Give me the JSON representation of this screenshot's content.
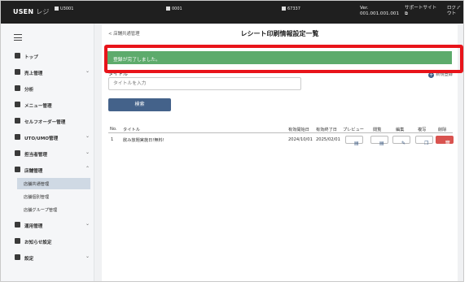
{
  "header": {
    "brand": "USEN",
    "brand_sub": "レジ",
    "store_code": "U3001",
    "terminal": "0001",
    "user": "67337",
    "version_label": "Ver.",
    "version": "001.001.001.001",
    "support_label": "サポートサイト",
    "logout_label": "ログアウト"
  },
  "sidebar": {
    "items": [
      {
        "label": "トップ"
      },
      {
        "label": "売上管理"
      },
      {
        "label": "分析"
      },
      {
        "label": "メニュー管理"
      },
      {
        "label": "セルフオーダー管理"
      },
      {
        "label": "UTO/UMO管理"
      },
      {
        "label": "担当者管理"
      },
      {
        "label": "店舗管理"
      },
      {
        "label": "運用管理"
      },
      {
        "label": "お知らせ設定"
      },
      {
        "label": "設定"
      }
    ],
    "subitems": [
      {
        "label": "店舗共通管理"
      },
      {
        "label": "店舗個別管理"
      },
      {
        "label": "店舗グループ管理"
      }
    ]
  },
  "main": {
    "back_label": "< 店舗共通管理",
    "page_title": "レシート印刷情報設定一覧",
    "alert_message": "登録が完了しました。",
    "field_label": "タイトル",
    "new_register_label": "新規登録",
    "title_placeholder": "タイトルを入力",
    "search_button": "検索",
    "table": {
      "columns": [
        "No.",
        "タイトル",
        "有効開始日",
        "有効終了日",
        "プレビュー",
        "閲覧",
        "編集",
        "複写",
        "削除"
      ],
      "rows": [
        {
          "no": "1",
          "title": "飲み放題実施日!無料!",
          "start": "2024/10/01",
          "end": "2025/02/01"
        }
      ]
    }
  },
  "colors": {
    "success": "#5dab6c",
    "primary": "#44628a",
    "highlight": "#e8141a",
    "danger": "#d9534f"
  }
}
